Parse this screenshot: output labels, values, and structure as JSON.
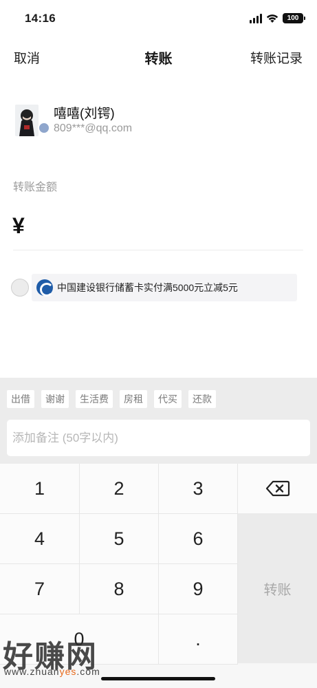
{
  "status_bar": {
    "time": "14:16",
    "battery": "100"
  },
  "nav": {
    "cancel": "取消",
    "title": "转账",
    "records": "转账记录"
  },
  "recipient": {
    "name": "嘻嘻(刘锷)",
    "account": "809***@qq.com"
  },
  "amount": {
    "label": "转账金额",
    "currency_symbol": "¥",
    "value": ""
  },
  "promo": {
    "text": "中国建设银行储蓄卡实付满5000元立减5元",
    "selected": false
  },
  "tags": [
    "出借",
    "谢谢",
    "生活费",
    "房租",
    "代买",
    "还款"
  ],
  "remark": {
    "placeholder": "添加备注 (50字以内)",
    "value": ""
  },
  "keypad": {
    "keys": [
      "1",
      "2",
      "3",
      "4",
      "5",
      "6",
      "7",
      "8",
      "9",
      "0",
      "."
    ],
    "transfer_label": "转账"
  },
  "watermark": {
    "big": "好赚网",
    "small_prefix": "www.zhuan",
    "small_highlight": "yes",
    "small_suffix": ".com"
  },
  "colors": {
    "bank_blue": "#1f5ca8",
    "panel_bg": "#ececec",
    "watermark_accent": "#e86a1c"
  }
}
